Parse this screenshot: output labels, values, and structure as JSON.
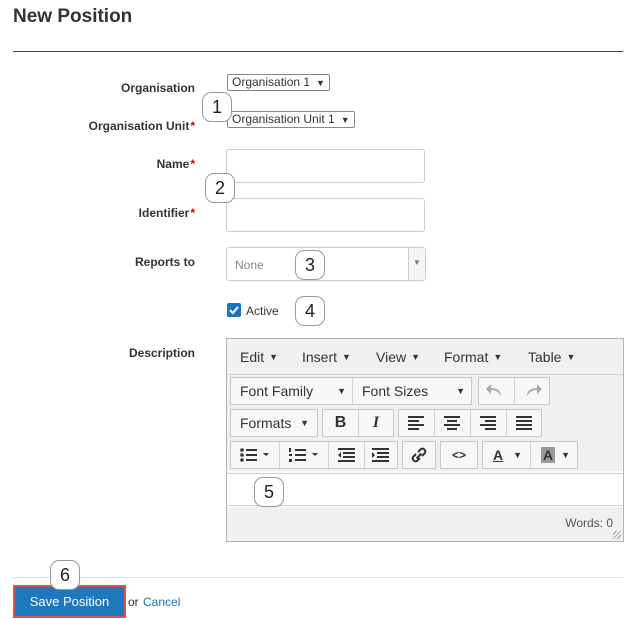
{
  "page": {
    "title": "New Position"
  },
  "form": {
    "organisation": {
      "label": "Organisation",
      "value": "Organisation 1"
    },
    "organisation_unit": {
      "label": "Organisation Unit",
      "required": "*",
      "value": "Organisation Unit 1"
    },
    "name": {
      "label": "Name",
      "required": "*",
      "value": ""
    },
    "identifier": {
      "label": "Identifier",
      "required": "*",
      "value": ""
    },
    "reports_to": {
      "label": "Reports to",
      "value": "None"
    },
    "active": {
      "label": "Active",
      "checked": true
    },
    "description": {
      "label": "Description"
    }
  },
  "editor": {
    "menus": [
      "Edit",
      "Insert",
      "View",
      "Format",
      "Table"
    ],
    "font_family": "Font Family",
    "font_sizes": "Font Sizes",
    "formats": "Formats",
    "bold": "B",
    "italic": "I",
    "code": "<>",
    "text_color": "A",
    "bg_color": "A",
    "words": "Words: 0"
  },
  "footer": {
    "save_label": "Save Position",
    "or": "or",
    "cancel_label": "Cancel"
  },
  "callouts": [
    "1",
    "2",
    "3",
    "4",
    "5",
    "6"
  ],
  "colors": {
    "primary": "#1f77bc",
    "required": "#cc0000",
    "highlight_border": "#d9534f",
    "link": "#1f6fb5"
  }
}
